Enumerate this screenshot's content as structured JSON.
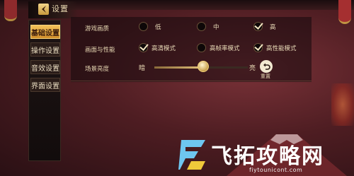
{
  "header": {
    "title": "设置"
  },
  "menu": {
    "items": [
      {
        "label": "基础设置",
        "active": true
      },
      {
        "label": "操作设置",
        "active": false
      },
      {
        "label": "音效设置",
        "active": false
      },
      {
        "label": "界面设置",
        "active": false
      }
    ]
  },
  "settings": {
    "quality": {
      "label": "游戏画质",
      "options": [
        {
          "label": "低",
          "checked": false
        },
        {
          "label": "中",
          "checked": false
        },
        {
          "label": "高",
          "checked": true
        }
      ]
    },
    "performance": {
      "label": "画面与性能",
      "options": [
        {
          "label": "高清模式",
          "checked": true
        },
        {
          "label": "高帧率模式",
          "checked": false
        },
        {
          "label": "高性能模式",
          "checked": true
        }
      ]
    },
    "brightness": {
      "label": "场景亮度",
      "min_label": "暗",
      "max_label": "亮",
      "value_fraction": 0.52
    },
    "reset_label": "重置"
  },
  "watermark": {
    "text": "飞拓攻略网",
    "url": "fiytounicont.com"
  },
  "colors": {
    "accent": "#f2c25a",
    "text": "#e6d6b2",
    "background": "#4e1d22"
  }
}
